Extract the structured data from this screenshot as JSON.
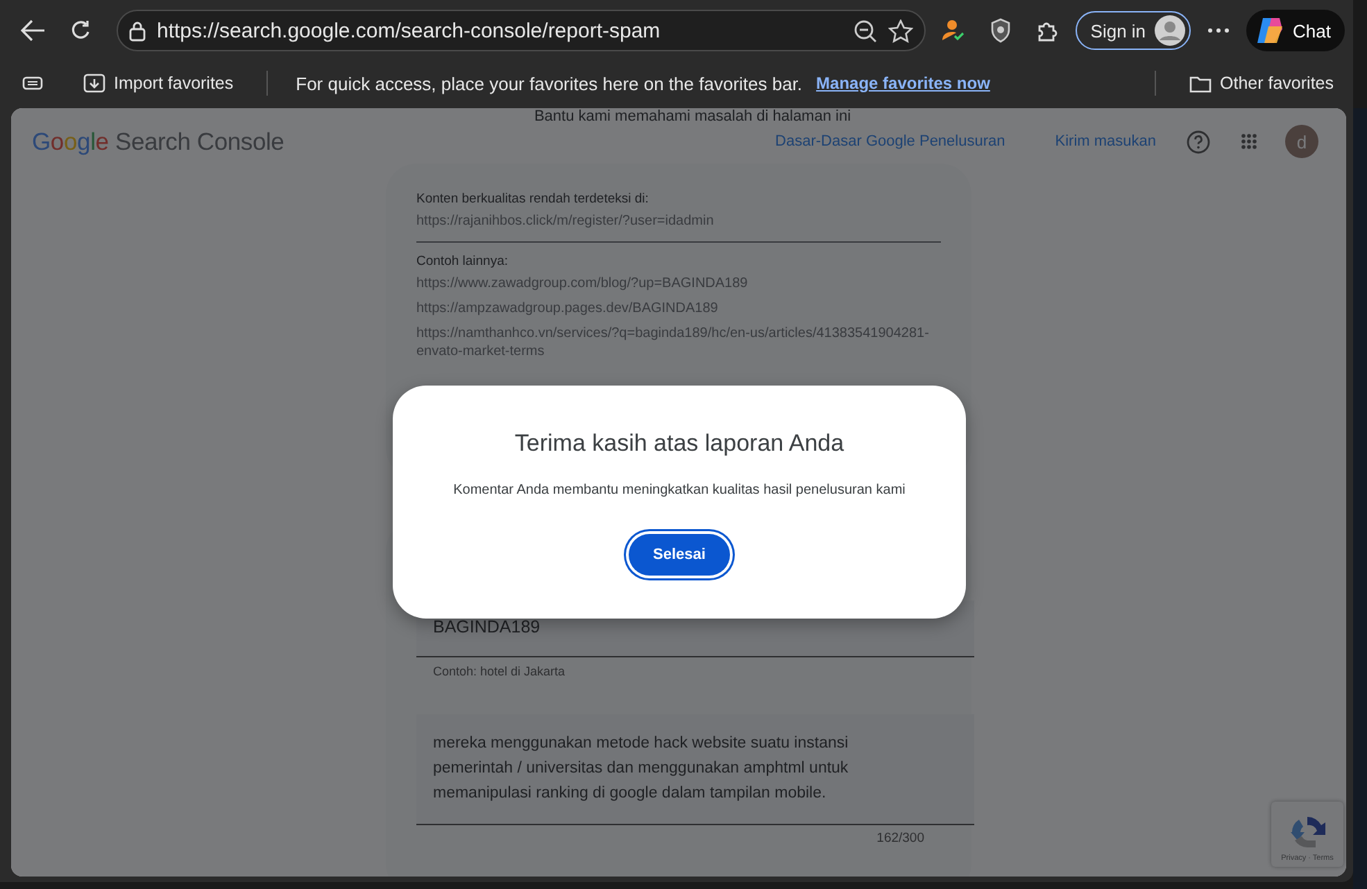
{
  "browser": {
    "url": "https://search.google.com/search-console/report-spam",
    "sign_in": "Sign in",
    "chat": "Chat"
  },
  "favorites_bar": {
    "import": "Import favorites",
    "message": "For quick access, place your favorites here on the favorites bar.",
    "link": "Manage favorites now",
    "other": "Other favorites"
  },
  "page": {
    "top_text": "Bantu kami memahami masalah di halaman ini",
    "logo": {
      "brand": "Google",
      "product": "Search Console"
    },
    "header_links": [
      "Dasar-Dasar Google Penelusuran",
      "Kirim masukan"
    ],
    "avatar_letter": "d",
    "report_card": {
      "detected_label": "Konten berkualitas rendah terdeteksi di:",
      "detected_url": "https://rajanihbos.click/m/register/?user=idadmin",
      "examples_label": "Contoh lainnya:",
      "example_urls": [
        "https://www.zawadgroup.com/blog/?up=BAGINDA189",
        "https://ampzawadgroup.pages.dev/BAGINDA189",
        "https://namthanhco.vn/services/?q=baginda189/hc/en-us/articles/41383541904281-envato-market-terms"
      ]
    },
    "details_card": {
      "keyword_field": {
        "value": "BAGINDA189",
        "helper": "Contoh: hotel di Jakarta"
      },
      "comment_field": {
        "value": "mereka menggunakan metode hack website suatu instansi pemerintah / universitas dan menggunakan amphtml untuk memanipulasi ranking di google dalam tampilan mobile.",
        "counter": "162/300"
      }
    },
    "recaptcha": {
      "links": "Privacy · Terms"
    }
  },
  "dialog": {
    "title": "Terima kasih atas laporan Anda",
    "message": "Komentar Anda membantu meningkatkan kualitas hasil penelusuran kami",
    "button": "Selesai"
  }
}
